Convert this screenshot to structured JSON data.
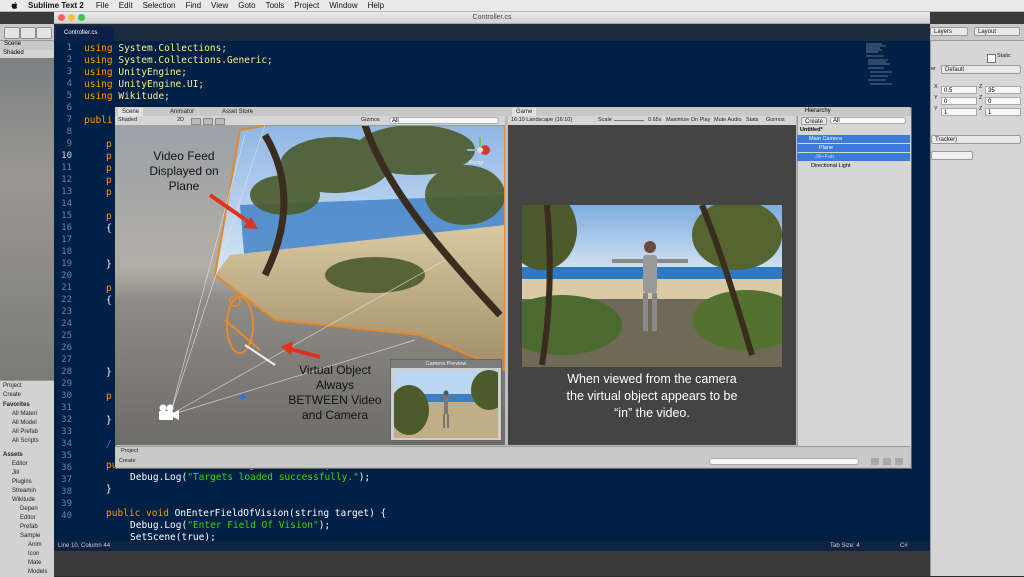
{
  "menubar": {
    "app_name": "Sublime Text 2",
    "items": [
      "File",
      "Edit",
      "Selection",
      "Find",
      "View",
      "Goto",
      "Tools",
      "Project",
      "Window",
      "Help"
    ]
  },
  "sublime": {
    "window_title": "Controller.cs",
    "tab_label": "Controller.cs",
    "status_left": "Line 10, Column 44",
    "status_tab": "Tab Size: 4",
    "status_syntax": "C#",
    "line_numbers": [
      "1",
      "2",
      "3",
      "4",
      "5",
      "6",
      "7",
      "8",
      "9",
      "10",
      "11",
      "12",
      "13",
      "14",
      "15",
      "16",
      "17",
      "18",
      "19",
      "20",
      "21",
      "22",
      "23",
      "24",
      "25",
      "26",
      "27",
      "28",
      "29",
      "30",
      "31",
      "32",
      "33",
      "34",
      "35",
      "36",
      "37",
      "38",
      "39",
      "40"
    ],
    "code": {
      "l1_kw": "using",
      "l1_ns": "System.Collections;",
      "l2_kw": "using",
      "l2_ns": "System.Collections.Generic;",
      "l3_kw": "using",
      "l3_ns": "UnityEngine;",
      "l4_kw": "using",
      "l4_ns": "UnityEngine.UI;",
      "l5_kw": "using",
      "l5_ns": "Wikitude;",
      "l7": "publi",
      "l9": "p",
      "l10": "p",
      "l11": "p",
      "l12": "p",
      "l13": "p",
      "l15": "p",
      "l16": "{",
      "l19": "}",
      "l21": "p",
      "l22": "{",
      "l28": "}",
      "l30": "p",
      "l32": "}",
      "l34": "/",
      "l35": "public virtual void OnTargetsLoaded() {",
      "l36_fn": "Debug.Log(",
      "l36_str": "\"Targets loaded successfully.\"",
      "l36_end": ");",
      "l37": "}",
      "l39_kw": "public void",
      "l39_rest": " OnEnterFieldOfVision(string target) {",
      "l40_fn": "Debug.Log(",
      "l40_str": "\"Enter Field Of Vision\"",
      "l40_end": ");",
      "l41": "SetScene(true);"
    }
  },
  "unity_bg": {
    "scene_tab": "Scene",
    "shaded": "Shaded",
    "layers": "Layers",
    "layout": "Layout",
    "static_label": "Static",
    "layer_label": "er",
    "layer_default": "Default",
    "transform": {
      "x1": "0.5",
      "y1": "0",
      "z1": "1",
      "x2": "35",
      "y2": "0",
      "z2": "1"
    },
    "tracker_label": "Tracker)",
    "project_tab": "Project",
    "create": "Create",
    "favorites": "Favorites",
    "fav_items": [
      "All Materi",
      "All Model",
      "All Prefab",
      "All Scripts"
    ],
    "assets": "Assets",
    "asset_items": [
      "Editor",
      "Jill",
      "Plugins",
      "Streamin",
      "Wikitude",
      "Depen",
      "Editor",
      "Prefab",
      "Sample",
      "Anim",
      "Icon",
      "Mate",
      "Models"
    ]
  },
  "overlay": {
    "scene_tab": "Scene",
    "animator_tab": "Animator",
    "asset_store_tab": "Asset Store",
    "game_tab": "Game",
    "hierarchy_tab": "Hierarchy",
    "scene_toolbar": {
      "shaded": "Shaded",
      "mode_2d": "2D",
      "gizmos": "Gizmos",
      "search": "All"
    },
    "game_toolbar": {
      "aspect": "16:10 Landscape (16:10)",
      "scale_label": "Scale",
      "scale_value": "0.65x",
      "maximize": "Maximize On Play",
      "mute": "Mute Audio",
      "stats": "Stats",
      "gizmos": "Gizmos"
    },
    "persp": "Persp",
    "camera_preview": "Camera Preview",
    "hierarchy": {
      "create": "Create",
      "search": "All",
      "rows": [
        "Untitled*",
        "Main Camera",
        "Plane",
        "Jill+Fab",
        "Directional Light"
      ]
    },
    "project_tab": "Project",
    "project_create": "Create"
  },
  "annotations": {
    "video_feed": [
      "Video Feed",
      "Displayed on",
      "Plane"
    ],
    "virtual_object": [
      "Virtual Object",
      "Always",
      "BETWEEN Video",
      "and Camera"
    ],
    "caption": [
      "When viewed from the camera",
      "the virtual object appears to be",
      "“in” the video."
    ]
  },
  "colors": {
    "code_bg": "#002045",
    "keyword": "#ff9d00",
    "namespace": "#ffee80",
    "string": "#3ad900",
    "arrow": "#e0301e",
    "selection": "#3d7bd9"
  }
}
